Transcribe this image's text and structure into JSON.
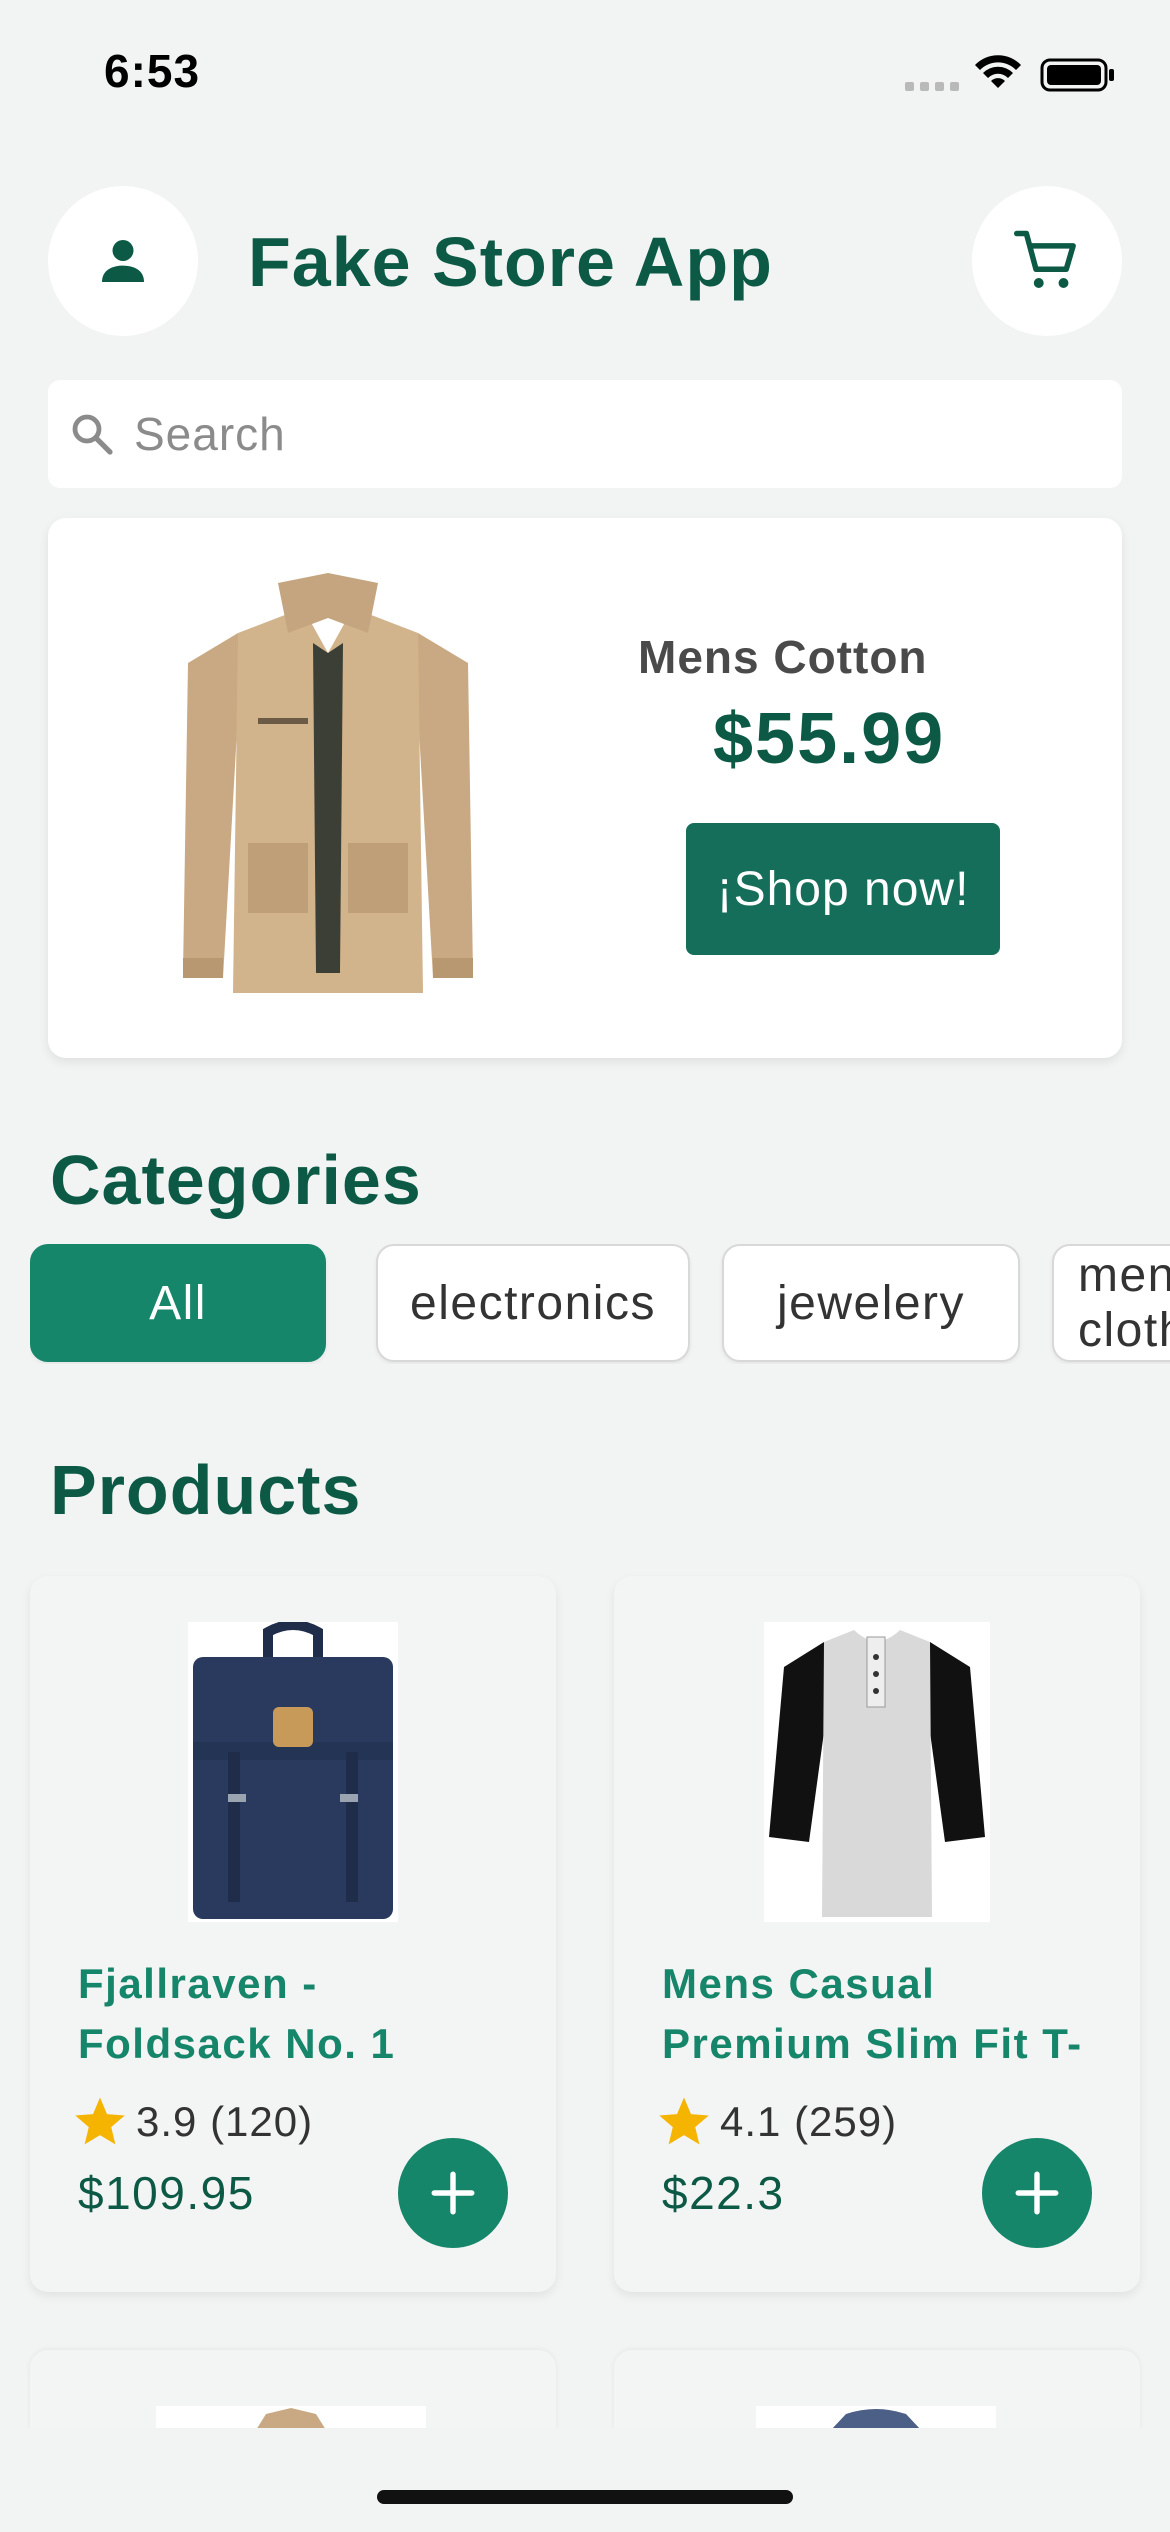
{
  "status_bar": {
    "time": "6:53"
  },
  "header": {
    "title": "Fake Store App"
  },
  "search": {
    "placeholder": "Search"
  },
  "banner": {
    "name": "Mens Cotton",
    "price": "$55.99",
    "cta_label": "¡Shop now!"
  },
  "categories": {
    "title": "Categories",
    "items": [
      "All",
      "electronics",
      "jewelery",
      "men's clothing"
    ],
    "active": "All"
  },
  "products": {
    "title": "Products",
    "items": [
      {
        "name": "Fjallraven - Foldsack No. 1",
        "rating": "3.9",
        "count": "(120)",
        "price": "$109.95"
      },
      {
        "name": "Mens Casual Premium Slim Fit T-",
        "rating": "4.1",
        "count": "(259)",
        "price": "$22.3"
      }
    ]
  },
  "colors": {
    "primary": "#0c5a45",
    "accent": "#16866b",
    "background": "#f2f3f3",
    "star": "#f5b400"
  },
  "icons": [
    "person-icon",
    "cart-icon",
    "search-icon",
    "star-icon",
    "plus-icon"
  ]
}
